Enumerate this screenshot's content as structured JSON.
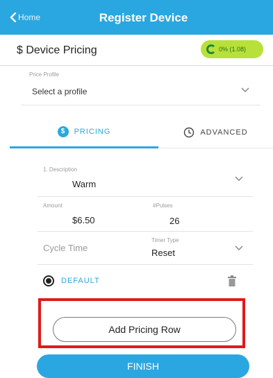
{
  "header": {
    "back_label": "Home",
    "title": "Register Device"
  },
  "subheader": {
    "title": "$ Device Pricing",
    "badge_text": "0% (1.08)"
  },
  "profile": {
    "label": "Price Profile",
    "value": "Select a profile"
  },
  "tabs": [
    {
      "label": "PRICING",
      "icon": "dollar-circle-icon",
      "active": true
    },
    {
      "label": "ADVANCED",
      "icon": "clock-icon",
      "active": false
    }
  ],
  "pricing_row": {
    "description_label": "1. Description",
    "description_value": "Warm",
    "amount_label": "Amount",
    "amount_value": "$6.50",
    "pulses_label": "#Pulses",
    "pulses_value": "26",
    "cycle_time_placeholder": "Cycle Time",
    "timer_type_label": "Timer Type",
    "timer_type_value": "Reset",
    "default_label": "DEFAULT"
  },
  "buttons": {
    "add_row": "Add Pricing Row",
    "finish": "FINISH"
  },
  "colors": {
    "primary": "#2aa7e0",
    "badge": "#b7e13a",
    "highlight": "#e01a1a"
  }
}
